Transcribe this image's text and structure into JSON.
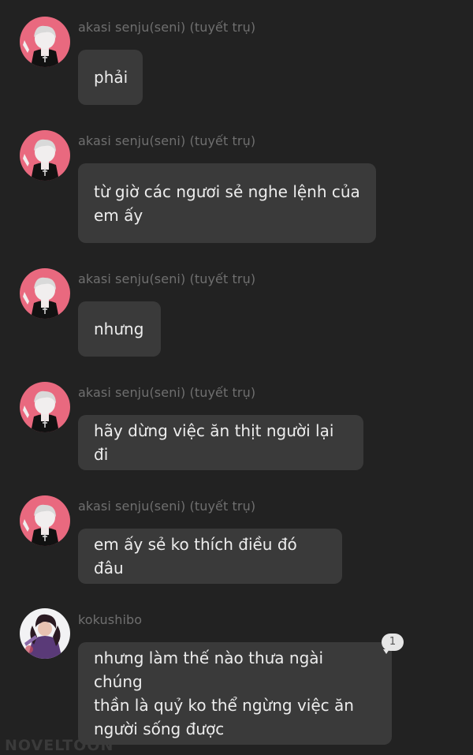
{
  "messages": [
    {
      "sender": "akasi senju(seni) (tuyết trụ)",
      "text": "phải",
      "avatar": "akasi-avatar"
    },
    {
      "sender": "akasi senju(seni) (tuyết trụ)",
      "text_lines": [
        "từ giờ các ngươi sẻ nghe lệnh của",
        "em ấy"
      ],
      "avatar": "akasi-avatar"
    },
    {
      "sender": "akasi senju(seni) (tuyết trụ)",
      "text": "nhưng",
      "avatar": "akasi-avatar"
    },
    {
      "sender": "akasi senju(seni) (tuyết trụ)",
      "text": "hãy dừng việc ăn thịt người lại đi",
      "avatar": "akasi-avatar"
    },
    {
      "sender": "akasi senju(seni) (tuyết trụ)",
      "text": "em ấy sẻ ko thích điều đó đâu",
      "avatar": "akasi-avatar"
    },
    {
      "sender": "kokushibo",
      "text_lines": [
        "nhưng làm thế nào thưa ngài chúng",
        "thần là quỷ ko thể ngừng việc ăn",
        "người sống được"
      ],
      "avatar": "kokushibo-avatar",
      "comment_count": "1"
    }
  ],
  "watermark": "NOVELTOON",
  "colors": {
    "background": "#222222",
    "bubble": "#3a3a3a",
    "sender_text": "#6f6f6f",
    "message_text": "#ededed",
    "avatar_pink": "#e9697f"
  }
}
